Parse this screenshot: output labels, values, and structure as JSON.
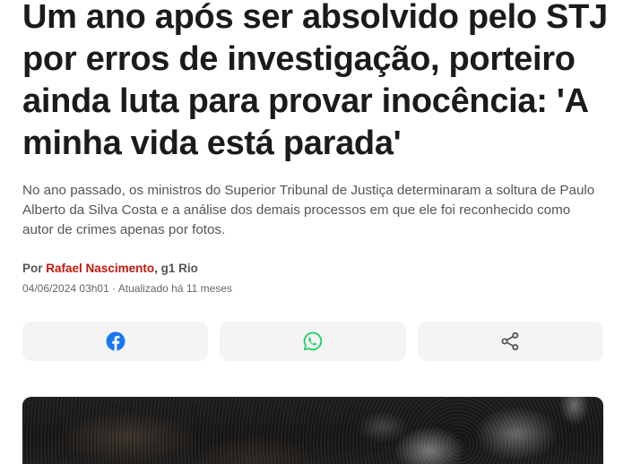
{
  "headline": {
    "lines": [
      "Um ano após ser absolvido pelo STJ",
      "por erros de investigação, porteiro",
      "ainda luta para provar inocência: 'A",
      "minha vida está parada'"
    ]
  },
  "subtitle": {
    "lines": [
      "No ano passado, os ministros do Superior Tribunal de Justiça determinaram a soltura de Paulo",
      "Alberto da Silva Costa e a análise dos demais processos em que ele foi reconhecido como",
      "autor de crimes apenas por fotos."
    ]
  },
  "byline": {
    "prefix": "Por",
    "author": "Rafael Nascimento",
    "separator": ",",
    "outlet": "g1 Rio"
  },
  "dateline": {
    "published": "04/06/2024 03h01",
    "separator": "·",
    "updated": "Atualizado há 11 meses"
  },
  "share_buttons": [
    {
      "icon": "facebook-icon",
      "color": "#1877f2"
    },
    {
      "icon": "whatsapp-icon",
      "color": "#25d366"
    },
    {
      "icon": "share-icon",
      "color": "#555555"
    }
  ],
  "colors": {
    "headline": "#1b1b1b",
    "body_text": "#555555",
    "author_link": "#c4170c",
    "share_button_background": "#f4f4f4"
  }
}
